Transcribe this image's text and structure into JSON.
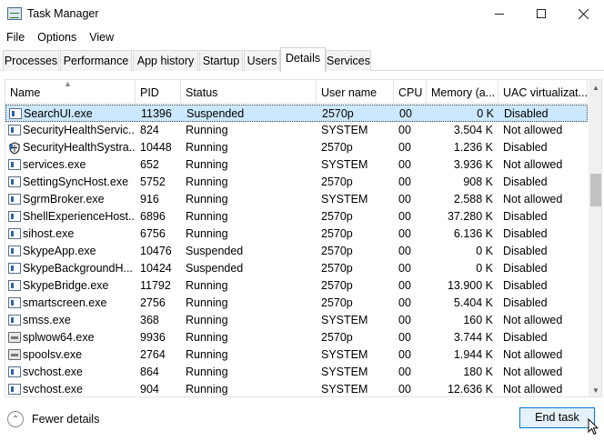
{
  "window": {
    "title": "Task Manager"
  },
  "menu": [
    "File",
    "Options",
    "View"
  ],
  "tabs": [
    "Processes",
    "Performance",
    "App history",
    "Startup",
    "Users",
    "Details",
    "Services"
  ],
  "active_tab": "Details",
  "columns": [
    "Name",
    "PID",
    "Status",
    "User name",
    "CPU",
    "Memory (a...",
    "UAC virtualizat..."
  ],
  "rows": [
    {
      "name": "SearchUI.exe",
      "pid": "11396",
      "status": "Suspended",
      "user": "2570p",
      "cpu": "00",
      "memory": "0 K",
      "uac": "Disabled",
      "icon": "app-icon",
      "selected": true
    },
    {
      "name": "SecurityHealthServic...",
      "pid": "824",
      "status": "Running",
      "user": "SYSTEM",
      "cpu": "00",
      "memory": "3.504 K",
      "uac": "Not allowed",
      "icon": "app-icon"
    },
    {
      "name": "SecurityHealthSystra...",
      "pid": "10448",
      "status": "Running",
      "user": "2570p",
      "cpu": "00",
      "memory": "1.236 K",
      "uac": "Disabled",
      "icon": "shield-icon"
    },
    {
      "name": "services.exe",
      "pid": "652",
      "status": "Running",
      "user": "SYSTEM",
      "cpu": "00",
      "memory": "3.936 K",
      "uac": "Not allowed",
      "icon": "app-icon"
    },
    {
      "name": "SettingSyncHost.exe",
      "pid": "5752",
      "status": "Running",
      "user": "2570p",
      "cpu": "00",
      "memory": "908 K",
      "uac": "Disabled",
      "icon": "app-icon"
    },
    {
      "name": "SgrmBroker.exe",
      "pid": "916",
      "status": "Running",
      "user": "SYSTEM",
      "cpu": "00",
      "memory": "2.588 K",
      "uac": "Not allowed",
      "icon": "app-icon"
    },
    {
      "name": "ShellExperienceHost....",
      "pid": "6896",
      "status": "Running",
      "user": "2570p",
      "cpu": "00",
      "memory": "37.280 K",
      "uac": "Disabled",
      "icon": "app-icon"
    },
    {
      "name": "sihost.exe",
      "pid": "6756",
      "status": "Running",
      "user": "2570p",
      "cpu": "00",
      "memory": "6.136 K",
      "uac": "Disabled",
      "icon": "app-icon"
    },
    {
      "name": "SkypeApp.exe",
      "pid": "10476",
      "status": "Suspended",
      "user": "2570p",
      "cpu": "00",
      "memory": "0 K",
      "uac": "Disabled",
      "icon": "app-icon"
    },
    {
      "name": "SkypeBackgroundH...",
      "pid": "10424",
      "status": "Suspended",
      "user": "2570p",
      "cpu": "00",
      "memory": "0 K",
      "uac": "Disabled",
      "icon": "app-icon"
    },
    {
      "name": "SkypeBridge.exe",
      "pid": "11792",
      "status": "Running",
      "user": "2570p",
      "cpu": "00",
      "memory": "13.900 K",
      "uac": "Disabled",
      "icon": "app-icon"
    },
    {
      "name": "smartscreen.exe",
      "pid": "2756",
      "status": "Running",
      "user": "2570p",
      "cpu": "00",
      "memory": "5.404 K",
      "uac": "Disabled",
      "icon": "app-icon"
    },
    {
      "name": "smss.exe",
      "pid": "368",
      "status": "Running",
      "user": "SYSTEM",
      "cpu": "00",
      "memory": "160 K",
      "uac": "Not allowed",
      "icon": "app-icon"
    },
    {
      "name": "splwow64.exe",
      "pid": "9936",
      "status": "Running",
      "user": "2570p",
      "cpu": "00",
      "memory": "3.744 K",
      "uac": "Disabled",
      "icon": "printer-icon"
    },
    {
      "name": "spoolsv.exe",
      "pid": "2764",
      "status": "Running",
      "user": "SYSTEM",
      "cpu": "00",
      "memory": "1.944 K",
      "uac": "Not allowed",
      "icon": "printer-icon"
    },
    {
      "name": "svchost.exe",
      "pid": "864",
      "status": "Running",
      "user": "SYSTEM",
      "cpu": "00",
      "memory": "180 K",
      "uac": "Not allowed",
      "icon": "app-icon"
    },
    {
      "name": "svchost.exe",
      "pid": "904",
      "status": "Running",
      "user": "SYSTEM",
      "cpu": "00",
      "memory": "12.636 K",
      "uac": "Not allowed",
      "icon": "app-icon"
    }
  ],
  "footer": {
    "fewer_details": "Fewer details",
    "end_task": "End task"
  },
  "colors": {
    "selected_row": "#cce8ff",
    "accent": "#0078d7",
    "button_bg": "#e5f1fb"
  }
}
